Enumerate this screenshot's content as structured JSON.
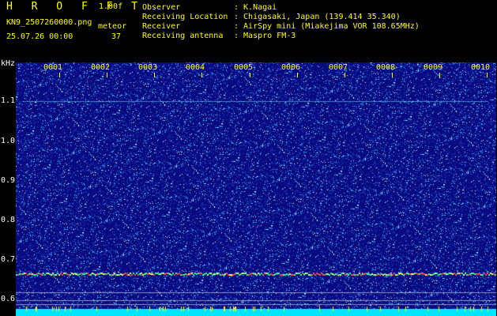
{
  "brand": "H R O F F T",
  "version": "1.00f",
  "filename": "KN9_2507260000.png",
  "mode": "meteor",
  "timestamp": "25.07.26 00:00",
  "count": "37",
  "info": [
    {
      "label": "Observer",
      "value": ": K.Nagai"
    },
    {
      "label": "Receiving Location",
      "value": ": Chigasaki, Japan (139.414 35.340)"
    },
    {
      "label": "Receiver",
      "value": ": AirSpy mini (Miakejima VOR 108.65MHz)"
    },
    {
      "label": "Receiving antenna",
      "value": ": Maspro FM-3"
    }
  ],
  "yaxis": {
    "unit": "kHz",
    "ticks": [
      "1.1",
      "1.0",
      "0.9",
      "0.8",
      "0.7",
      "0.6"
    ]
  },
  "xaxis": {
    "ticks": [
      "0001",
      "0002",
      "0003",
      "0004",
      "0005",
      "0006",
      "0007",
      "0008",
      "0009",
      "0010"
    ]
  },
  "colors": {
    "background": "#000000",
    "label_yellow": "#ffff00",
    "label_white": "#ffffff",
    "waterfall_base": "#0a0a78",
    "noise_strong": "#ffffff",
    "carrier_line": "#ff4040",
    "baseline_bar": "#00e5ff"
  }
}
